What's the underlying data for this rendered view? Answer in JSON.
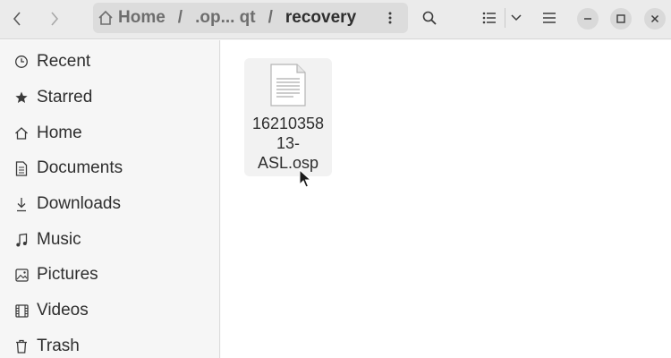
{
  "window": {
    "path": {
      "home_label": "Home",
      "middle_label": ".op... qt",
      "current_label": "recovery",
      "separator": "/"
    },
    "icons": {
      "back": "chevron-left-icon",
      "forward": "chevron-right-icon",
      "path_menu": "vertical-dots-icon",
      "search": "search-icon",
      "view": "list-view-icon",
      "view_options": "chevron-down-icon",
      "menu": "hamburger-menu-icon",
      "minimize": "minimize-icon",
      "maximize": "maximize-icon",
      "close": "close-icon"
    }
  },
  "sidebar": {
    "items": [
      {
        "label": "Recent",
        "icon": "clock-icon"
      },
      {
        "label": "Starred",
        "icon": "star-icon"
      },
      {
        "label": "Home",
        "icon": "home-icon"
      },
      {
        "label": "Documents",
        "icon": "document-icon"
      },
      {
        "label": "Downloads",
        "icon": "download-icon"
      },
      {
        "label": "Music",
        "icon": "music-icon"
      },
      {
        "label": "Pictures",
        "icon": "picture-icon"
      },
      {
        "label": "Videos",
        "icon": "video-icon"
      },
      {
        "label": "Trash",
        "icon": "trash-icon"
      }
    ]
  },
  "content": {
    "files": [
      {
        "name": "1621035813-ASL.osp",
        "name_lines": [
          "16210358",
          "13-",
          "ASL.osp"
        ],
        "icon": "text-file-icon"
      }
    ]
  }
}
